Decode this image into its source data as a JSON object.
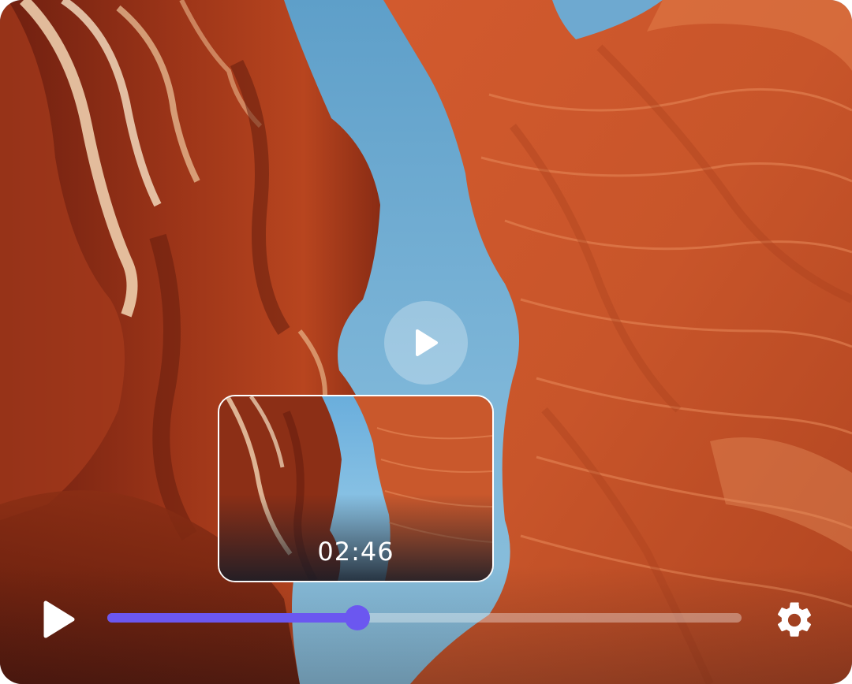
{
  "player": {
    "preview_time": "02:46",
    "progress_fraction": 0.394,
    "accent_color": "#6b57f0"
  },
  "controls": {
    "play_icon": "play-icon",
    "center_play_icon": "play-icon",
    "settings_icon": "gear-icon"
  }
}
